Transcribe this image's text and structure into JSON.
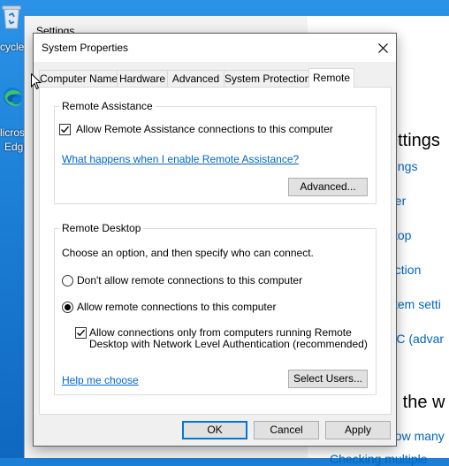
{
  "desktop": {
    "icons": [
      {
        "name": "recycle-bin",
        "label": "cycle"
      },
      {
        "name": "microsoft-edge",
        "label_line1": "licros",
        "label_line2": "Edge"
      }
    ]
  },
  "settings_window": {
    "title": "Settings",
    "right_panel": {
      "heading": "ettings",
      "links": [
        "ttings",
        "ger",
        "ktop",
        "ection",
        "stem setti",
        "PC (advar"
      ],
      "heading2": "n the w",
      "link_bottom": "how many",
      "link_bottom2": "Checking multiple"
    }
  },
  "dialog": {
    "title": "System Properties",
    "tabs": [
      "Computer Name",
      "Hardware",
      "Advanced",
      "System Protection",
      "Remote"
    ],
    "active_tab": "Remote",
    "remote_assistance": {
      "group_label": "Remote Assistance",
      "allow_checkbox_label": "Allow Remote Assistance connections to this computer",
      "allow_checked": true,
      "help_link": "What happens when I enable Remote Assistance?",
      "advanced_button": "Advanced..."
    },
    "remote_desktop": {
      "group_label": "Remote Desktop",
      "instruction": "Choose an option, and then specify who can connect.",
      "option_dont_allow": "Don't allow remote connections to this computer",
      "option_allow": "Allow remote connections to this computer",
      "selected_option": "allow",
      "nla_label_line1": "Allow connections only from computers running Remote",
      "nla_label_line2": "Desktop with Network Level Authentication (recommended)",
      "nla_checked": true,
      "help_link": "Help me choose",
      "select_users_button": "Select Users..."
    },
    "buttons": {
      "ok": "OK",
      "cancel": "Cancel",
      "apply": "Apply"
    }
  },
  "colors": {
    "desktop_blue": "#1b7fd8",
    "link_blue": "#0066cc",
    "settings_link_blue": "#0067c0",
    "default_button_border": "#0078d7"
  }
}
